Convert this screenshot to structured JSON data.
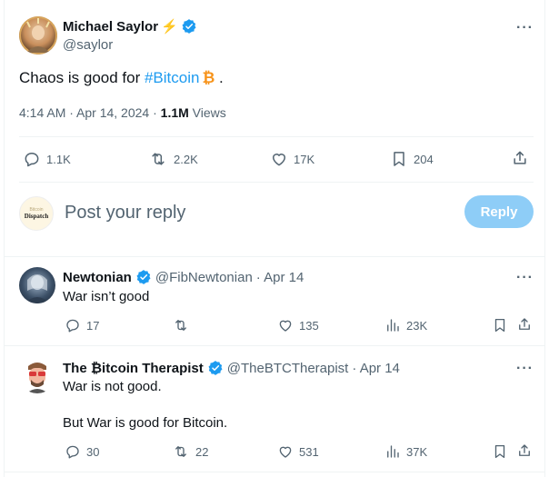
{
  "main_tweet": {
    "author_name": "Michael Saylor",
    "author_emoji": "⚡",
    "handle": "@saylor",
    "text_before": "Chaos is good for ",
    "hashtag": "#Bitcoin",
    "bitcoin_emoji": "₿",
    "text_after": " .",
    "time": "4:14 AM · Apr 14, 2024 · ",
    "views_count": "1.1M",
    "views_label": " Views",
    "actions": {
      "replies": "1.1K",
      "reposts": "2.2K",
      "likes": "17K",
      "bookmarks": "204"
    }
  },
  "composer": {
    "avatar_line1": "Bitcoin",
    "avatar_line2": "Dispatch",
    "placeholder": "Post your reply",
    "reply_button": "Reply"
  },
  "replies": [
    {
      "name": "Newtonian",
      "handle": "@FibNewtonian",
      "date": "· Apr 14",
      "text": "War isn’t good",
      "replies": "17",
      "reposts": "",
      "likes": "135",
      "views": "23K"
    },
    {
      "name": "The ₿itcoin Therapist",
      "handle": "@TheBTCTherapist",
      "date": "· Apr 14",
      "text1": "War is not good.",
      "text2": "But War is good for Bitcoin.",
      "replies": "30",
      "reposts": "22",
      "likes": "531",
      "views": "37K"
    }
  ],
  "colors": {
    "accent": "#1d9bf0",
    "reply_button_bg": "#8ecdf7",
    "bitcoin_orange": "#f7931a",
    "verified_blue": "#1d9bf0"
  }
}
